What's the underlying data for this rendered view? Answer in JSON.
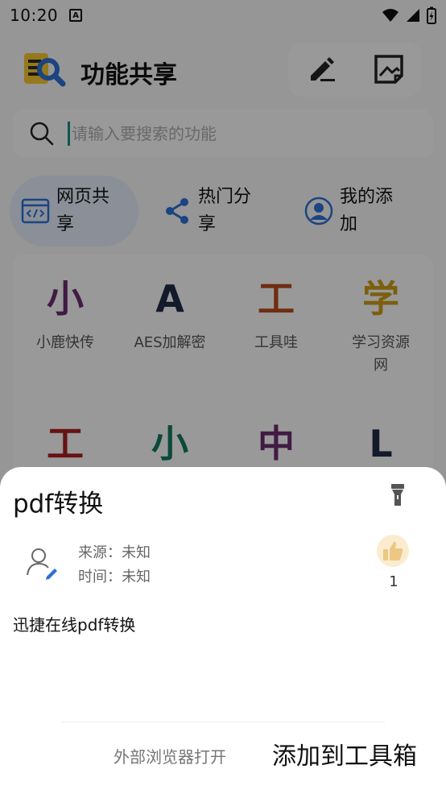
{
  "status_bar": {
    "time": "10:20",
    "notification_icon": "A"
  },
  "header": {
    "title": "功能共享"
  },
  "search": {
    "placeholder": "请输入要搜索的功能"
  },
  "tabs": [
    {
      "label": "网页共享",
      "active": true
    },
    {
      "label": "热门分享",
      "active": false
    },
    {
      "label": "我的添加",
      "active": false
    }
  ],
  "grid": [
    {
      "glyph": "小",
      "name": "小鹿快传",
      "color": "#6a2c6e"
    },
    {
      "glyph": "A",
      "name": "AES加解密",
      "color": "#1f2a44"
    },
    {
      "glyph": "工",
      "name": "工具哇",
      "color": "#b34a1a"
    },
    {
      "glyph": "学",
      "name": "学习资源网",
      "color": "#c99a18"
    },
    {
      "glyph": "工",
      "name": "",
      "color": "#a82020"
    },
    {
      "glyph": "小",
      "name": "",
      "color": "#14775e"
    },
    {
      "glyph": "中",
      "name": "",
      "color": "#6a2c6e"
    },
    {
      "glyph": "L",
      "name": "",
      "color": "#1f2a44"
    }
  ],
  "sheet": {
    "title": "pdf转换",
    "source": "来源：未知",
    "time": "时间：未知",
    "like_count": "1",
    "description": "迅捷在线pdf转换",
    "open_external_label": "外部浏览器打开",
    "add_label": "添加到工具箱"
  }
}
